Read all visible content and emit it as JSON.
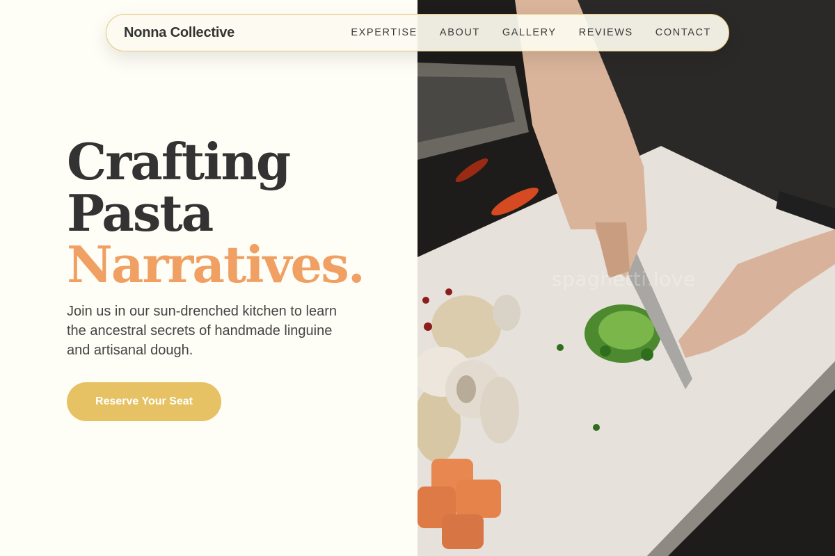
{
  "nav": {
    "brand": "Nonna Collective",
    "links": [
      "EXPERTISE",
      "ABOUT",
      "GALLERY",
      "REVIEWS",
      "CONTACT"
    ]
  },
  "hero": {
    "title_line1": "Crafting",
    "title_line2": "Pasta",
    "title_line3": "Narratives.",
    "description": "Join us in our sun-drenched kitchen to learn the ancestral secrets of handmade linguine and artisanal dough.",
    "cta_label": "Reserve Your Seat"
  },
  "photo": {
    "watermark": "spaghetti.love",
    "description_icon": "kitchen-photo"
  },
  "colors": {
    "background": "#fefdf6",
    "accent_orange": "#f0a062",
    "button_gold": "#e6c264",
    "nav_border": "#e6c876",
    "text_dark": "#333333"
  }
}
